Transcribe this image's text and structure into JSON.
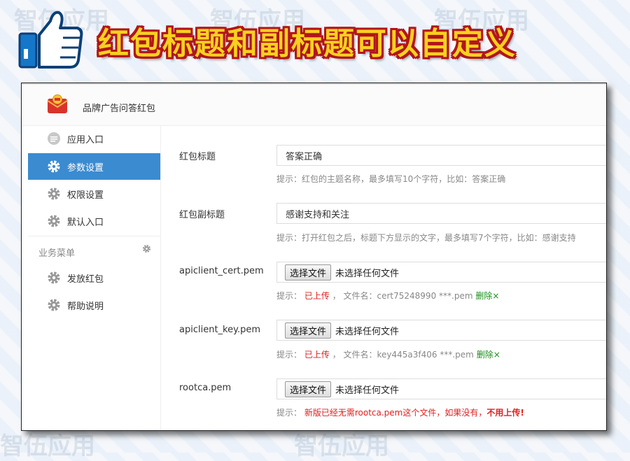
{
  "banner": {
    "headline": "红包标题和副标题可以自定义",
    "thumb_icon": "thumbs-up-icon"
  },
  "watermark": {
    "text": "智伍应用",
    "url": "zhiwu55.com"
  },
  "app": {
    "title": "品牌广告问答红包",
    "logo_icon": "red-envelope-logo-icon"
  },
  "sidebar": {
    "items": [
      {
        "label": "应用入口",
        "icon": "chat-bubble-icon",
        "active": false
      },
      {
        "label": "参数设置",
        "icon": "gear-icon",
        "active": true
      },
      {
        "label": "权限设置",
        "icon": "gear-icon",
        "active": false
      },
      {
        "label": "默认入口",
        "icon": "gear-icon",
        "active": false
      }
    ],
    "section_label": "业务菜单",
    "section_items": [
      {
        "label": "发放红包",
        "icon": "gear-icon"
      },
      {
        "label": "帮助说明",
        "icon": "gear-icon"
      }
    ]
  },
  "form": {
    "title_field": {
      "label": "红包标题",
      "value": "答案正确",
      "hint": "提示：红包的主题名称，最多填写10个字符，比如：答案正确"
    },
    "subtitle_field": {
      "label": "红包副标题",
      "value": "感谢支持和关注",
      "hint": "提示：打开红包之后，标题下方显示的文字，最多填写7个字符，比如：感谢支持"
    },
    "cert_field": {
      "label": "apiclient_cert.pem",
      "button": "选择文件",
      "none": "未选择任何文件",
      "hint_prefix": "提示：",
      "uploaded": "已上传",
      "file_label": "，  文件名：cert75248990 ***.pem",
      "delete": "删除×"
    },
    "key_field": {
      "label": "apiclient_key.pem",
      "button": "选择文件",
      "none": "未选择任何文件",
      "hint_prefix": "提示：",
      "uploaded": "已上传",
      "file_label": "，  文件名：key445a3f406 ***.pem",
      "delete": "删除×"
    },
    "rootca_field": {
      "label": "rootca.pem",
      "button": "选择文件",
      "none": "未选择任何文件",
      "hint_prefix": "提示：",
      "notice": "新版已经无需rootca.pem这个文件，如果没有，",
      "notice_bold": "不用上传!"
    }
  },
  "colors": {
    "accent": "#3b8bd1",
    "headline": "#f7d11f",
    "headline_outline": "#b2141b",
    "warn": "#e02020",
    "ok": "#1a8f1a"
  }
}
